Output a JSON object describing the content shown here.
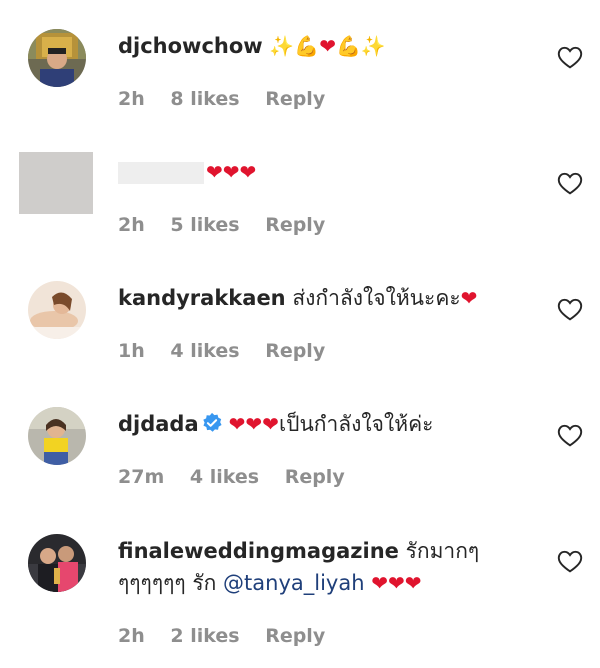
{
  "colors": {
    "username": "#262626",
    "meta": "#8e8e8e",
    "mention": "#1f3f7a",
    "heart": "#e0142e",
    "verified": "#3897f0"
  },
  "comments": [
    {
      "username": "djchowchow",
      "text": "",
      "emojis": [
        "sparkles",
        "flexed-biceps",
        "red-heart",
        "flexed-biceps",
        "sparkles"
      ],
      "time": "2h",
      "likes": "8 likes",
      "reply": "Reply"
    },
    {
      "username": "",
      "text": "",
      "emojis": [
        "red-heart",
        "red-heart",
        "red-heart"
      ],
      "time": "2h",
      "likes": "5 likes",
      "reply": "Reply"
    },
    {
      "username": "kandyrakkaen",
      "text": "ส่งกำลังใจให้นะคะ",
      "emojis": [
        "red-heart"
      ],
      "time": "1h",
      "likes": "4 likes",
      "reply": "Reply"
    },
    {
      "username": "djdada",
      "verified": true,
      "text": "เป็นกำลังใจให้ค่ะ",
      "emojis": [
        "red-heart",
        "red-heart",
        "red-heart"
      ],
      "time": "27m",
      "likes": "4 likes",
      "reply": "Reply"
    },
    {
      "username": "finaleweddingmagazine",
      "text": "รักมากๆ ๆๆๆๆๆๆ รัก",
      "mention": "@tanya_liyah",
      "emojis": [
        "red-heart",
        "red-heart",
        "red-heart"
      ],
      "time": "2h",
      "likes": "2 likes",
      "reply": "Reply"
    }
  ]
}
